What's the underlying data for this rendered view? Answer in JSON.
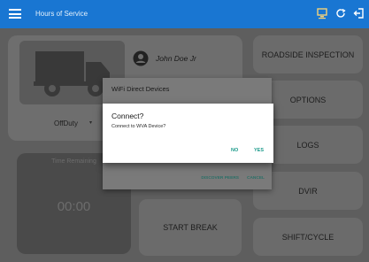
{
  "appbar": {
    "title": "Hours of Service",
    "menu_icon": "menu-icon",
    "icons": [
      "device-icon",
      "refresh-icon",
      "logout-icon"
    ]
  },
  "driver": {
    "name": "John Doe Jr",
    "avatar_icon": "account-circle-icon"
  },
  "status": {
    "duty": "OffDuty",
    "caret": "▾"
  },
  "time_card": {
    "label": "Time Remaining",
    "value": "00:00"
  },
  "start_break": "START BREAK",
  "nav_buttons": {
    "roadside": "ROADSIDE INSPECTION",
    "options": "OPTIONS",
    "logs": "LOGS",
    "dvir": "DVIR",
    "shift_cycle": "SHIFT/CYCLE"
  },
  "wifi_panel": {
    "title": "WiFi Direct Devices",
    "discover": "DISCOVER PEERS",
    "cancel": "CANCEL"
  },
  "dialog": {
    "title": "Connect?",
    "message": "Connect to WVA Device?",
    "no": "NO",
    "yes": "YES"
  },
  "colors": {
    "appbar": "#1976d2",
    "accent": "#1b9a8a",
    "overlay": "#5e5e5e"
  }
}
